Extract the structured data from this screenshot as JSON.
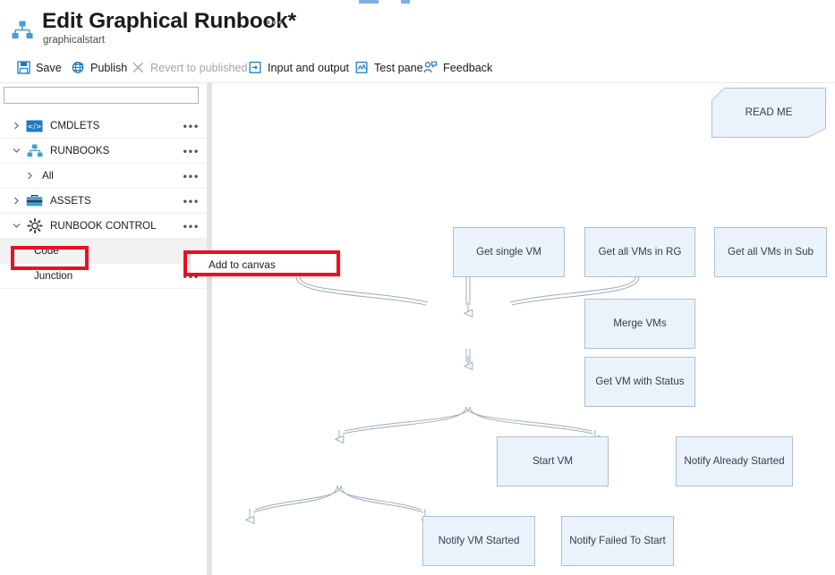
{
  "header": {
    "title": "Edit Graphical Runbook*",
    "subtitle": "graphicalstart",
    "ellipsis": "•••",
    "icon": "runbook-hierarchy-icon"
  },
  "commandbar": {
    "items": [
      {
        "label": "Save",
        "icon": "save-icon",
        "enabled": true
      },
      {
        "label": "Publish",
        "icon": "globe-icon",
        "enabled": true
      },
      {
        "label": "Revert to published",
        "icon": "close-x-icon",
        "enabled": false
      },
      {
        "label": "Input and output",
        "icon": "input-output-icon",
        "enabled": true
      },
      {
        "label": "Test pane",
        "icon": "test-chart-icon",
        "enabled": true
      },
      {
        "label": "Feedback",
        "icon": "feedback-person-icon",
        "enabled": true
      }
    ]
  },
  "library": {
    "search": {
      "value": "",
      "placeholder": ""
    },
    "tree": [
      {
        "label": "CMDLETS",
        "expanded": false,
        "level": 0,
        "icon": "code-brackets-icon",
        "selected": false,
        "ellipsis": "•••"
      },
      {
        "label": "RUNBOOKS",
        "expanded": true,
        "level": 0,
        "icon": "runbook-hierarchy-icon",
        "selected": false,
        "ellipsis": "•••"
      },
      {
        "label": "All",
        "expanded": false,
        "level": 1,
        "icon": "",
        "selected": false,
        "ellipsis": "•••"
      },
      {
        "label": "ASSETS",
        "expanded": false,
        "level": 0,
        "icon": "briefcase-icon",
        "selected": false,
        "ellipsis": "•••"
      },
      {
        "label": "RUNBOOK CONTROL",
        "expanded": true,
        "level": 0,
        "icon": "gear-icon",
        "selected": false,
        "ellipsis": "•••"
      },
      {
        "label": "Code",
        "expanded": null,
        "level": 1,
        "icon": "",
        "selected": true,
        "ellipsis": ""
      },
      {
        "label": "Junction",
        "expanded": null,
        "level": 1,
        "icon": "",
        "selected": false,
        "ellipsis": "•••"
      }
    ]
  },
  "context_menu": {
    "item": "Add to canvas"
  },
  "annotations": [
    {
      "name": "code-highlight",
      "color": "#e81123"
    },
    {
      "name": "add-to-canvas-highlight",
      "color": "#e81123"
    }
  ],
  "canvas": {
    "nodes": [
      {
        "id": "readme",
        "label": "READ ME"
      },
      {
        "id": "get-single-vm",
        "label": "Get single VM"
      },
      {
        "id": "get-all-rg",
        "label": "Get all VMs in RG"
      },
      {
        "id": "get-all-sub",
        "label": "Get all VMs in Sub"
      },
      {
        "id": "merge-vms",
        "label": "Merge VMs"
      },
      {
        "id": "get-vm-status",
        "label": "Get VM with Status"
      },
      {
        "id": "start-vm",
        "label": "Start VM"
      },
      {
        "id": "notify-already",
        "label": "Notify Already Started"
      },
      {
        "id": "notify-started",
        "label": "Notify VM Started"
      },
      {
        "id": "notify-failed",
        "label": "Notify Failed To Start"
      }
    ],
    "colors": {
      "node_fill": "#eaf3fb",
      "node_border": "#aebfd0",
      "connector": "#9bacbd",
      "node_text": "#333f4e"
    }
  }
}
